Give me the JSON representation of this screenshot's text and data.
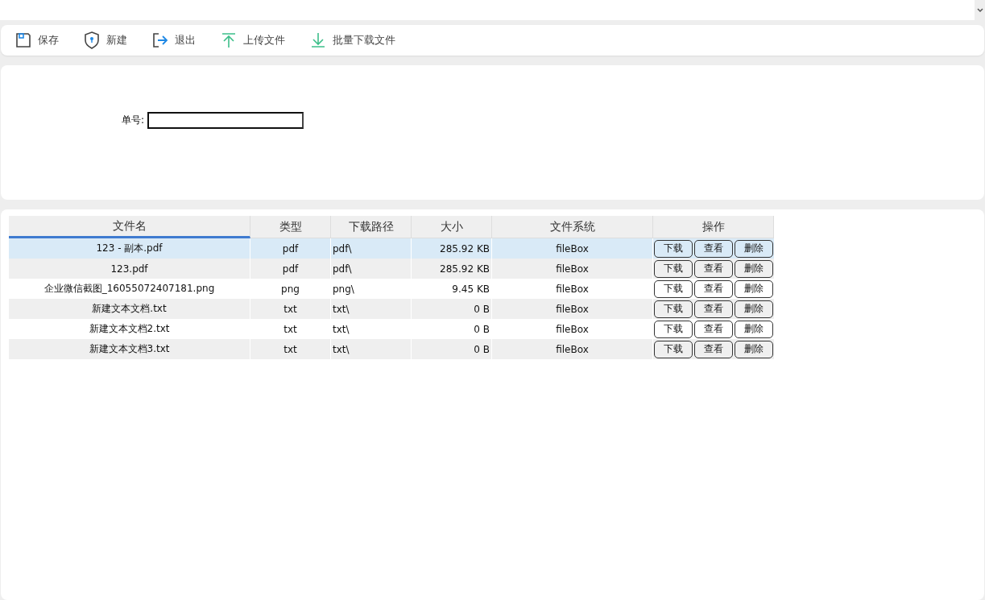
{
  "toolbar": [
    {
      "kind": "save",
      "label": "保存"
    },
    {
      "kind": "new",
      "label": "新建"
    },
    {
      "kind": "exit",
      "label": "退出"
    },
    {
      "kind": "upload",
      "label": "上传文件"
    },
    {
      "kind": "download",
      "label": "批量下载文件"
    }
  ],
  "form": {
    "label": "单号:"
  },
  "table": {
    "columns": [
      {
        "label": "文件名",
        "sorted": true
      },
      {
        "label": "类型",
        "sorted": false
      },
      {
        "label": "下载路径",
        "sorted": false
      },
      {
        "label": "大小",
        "sorted": false
      },
      {
        "label": "文件系统",
        "sorted": false
      },
      {
        "label": "操作",
        "sorted": false
      }
    ],
    "rows": [
      {
        "selected": true,
        "name": "123 - 副本.pdf",
        "type": "pdf",
        "path": "pdf\\",
        "size": "285.92 KB",
        "fs": "fileBox",
        "actions": [
          "下载",
          "查看",
          "删除"
        ]
      },
      {
        "selected": false,
        "name": "123.pdf",
        "type": "pdf",
        "path": "pdf\\",
        "size": "285.92 KB",
        "fs": "fileBox",
        "actions": [
          "下载",
          "查看",
          "删除"
        ]
      },
      {
        "selected": false,
        "name": "企业微信截图_16055072407181.png",
        "type": "png",
        "path": "png\\",
        "size": "9.45 KB",
        "fs": "fileBox",
        "actions": [
          "下载",
          "查看",
          "删除"
        ]
      },
      {
        "selected": false,
        "name": "新建文本文档.txt",
        "type": "txt",
        "path": "txt\\",
        "size": "0 B",
        "fs": "fileBox",
        "actions": [
          "下载",
          "查看",
          "删除"
        ]
      },
      {
        "selected": false,
        "name": "新建文本文档2.txt",
        "type": "txt",
        "path": "txt\\",
        "size": "0 B",
        "fs": "fileBox",
        "actions": [
          "下载",
          "查看",
          "删除"
        ]
      },
      {
        "selected": false,
        "name": "新建文本文档3.txt",
        "type": "txt",
        "path": "txt\\",
        "size": "0 B",
        "fs": "fileBox",
        "actions": [
          "下载",
          "查看",
          "删除"
        ]
      }
    ]
  }
}
